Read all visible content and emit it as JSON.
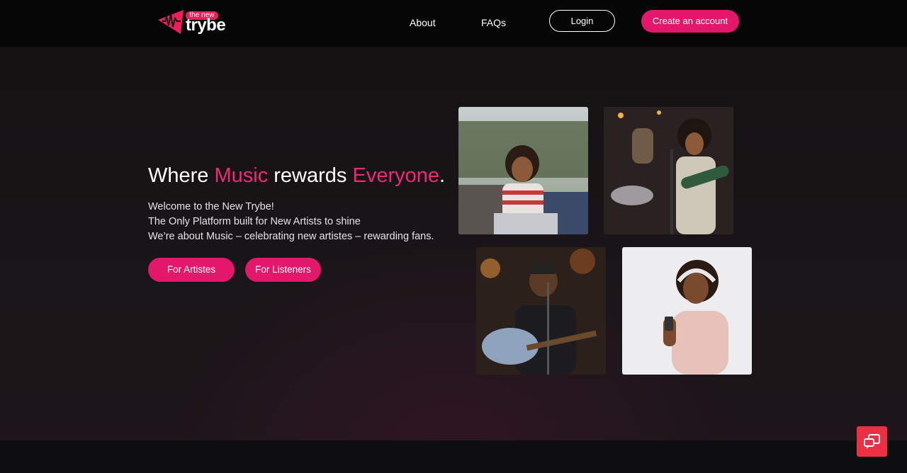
{
  "header": {
    "logo_small": "the new",
    "logo_big": "trybe",
    "nav": [
      {
        "label": "About"
      },
      {
        "label": "FAQs"
      }
    ],
    "login_label": "Login",
    "create_label": "Create an account"
  },
  "hero": {
    "headline": {
      "part1": "Where ",
      "accent1": "Music",
      "part2": " rewards ",
      "accent2": "Everyone",
      "part3": "."
    },
    "lines": [
      "Welcome to the New Trybe!",
      "The Only Platform built for New Artists to shine",
      "We’re about Music – celebrating new artistes – rewarding fans."
    ],
    "buttons": {
      "artistes": "For Artistes",
      "listeners": "For Listeners"
    }
  },
  "colors": {
    "accent": "#e3186a",
    "header_bg": "#060606",
    "page_bg": "#151214",
    "chat_button": "#ec2f45"
  },
  "icons": {
    "logo": "trybe-logo-icon",
    "chat": "chat-bubbles-icon"
  }
}
